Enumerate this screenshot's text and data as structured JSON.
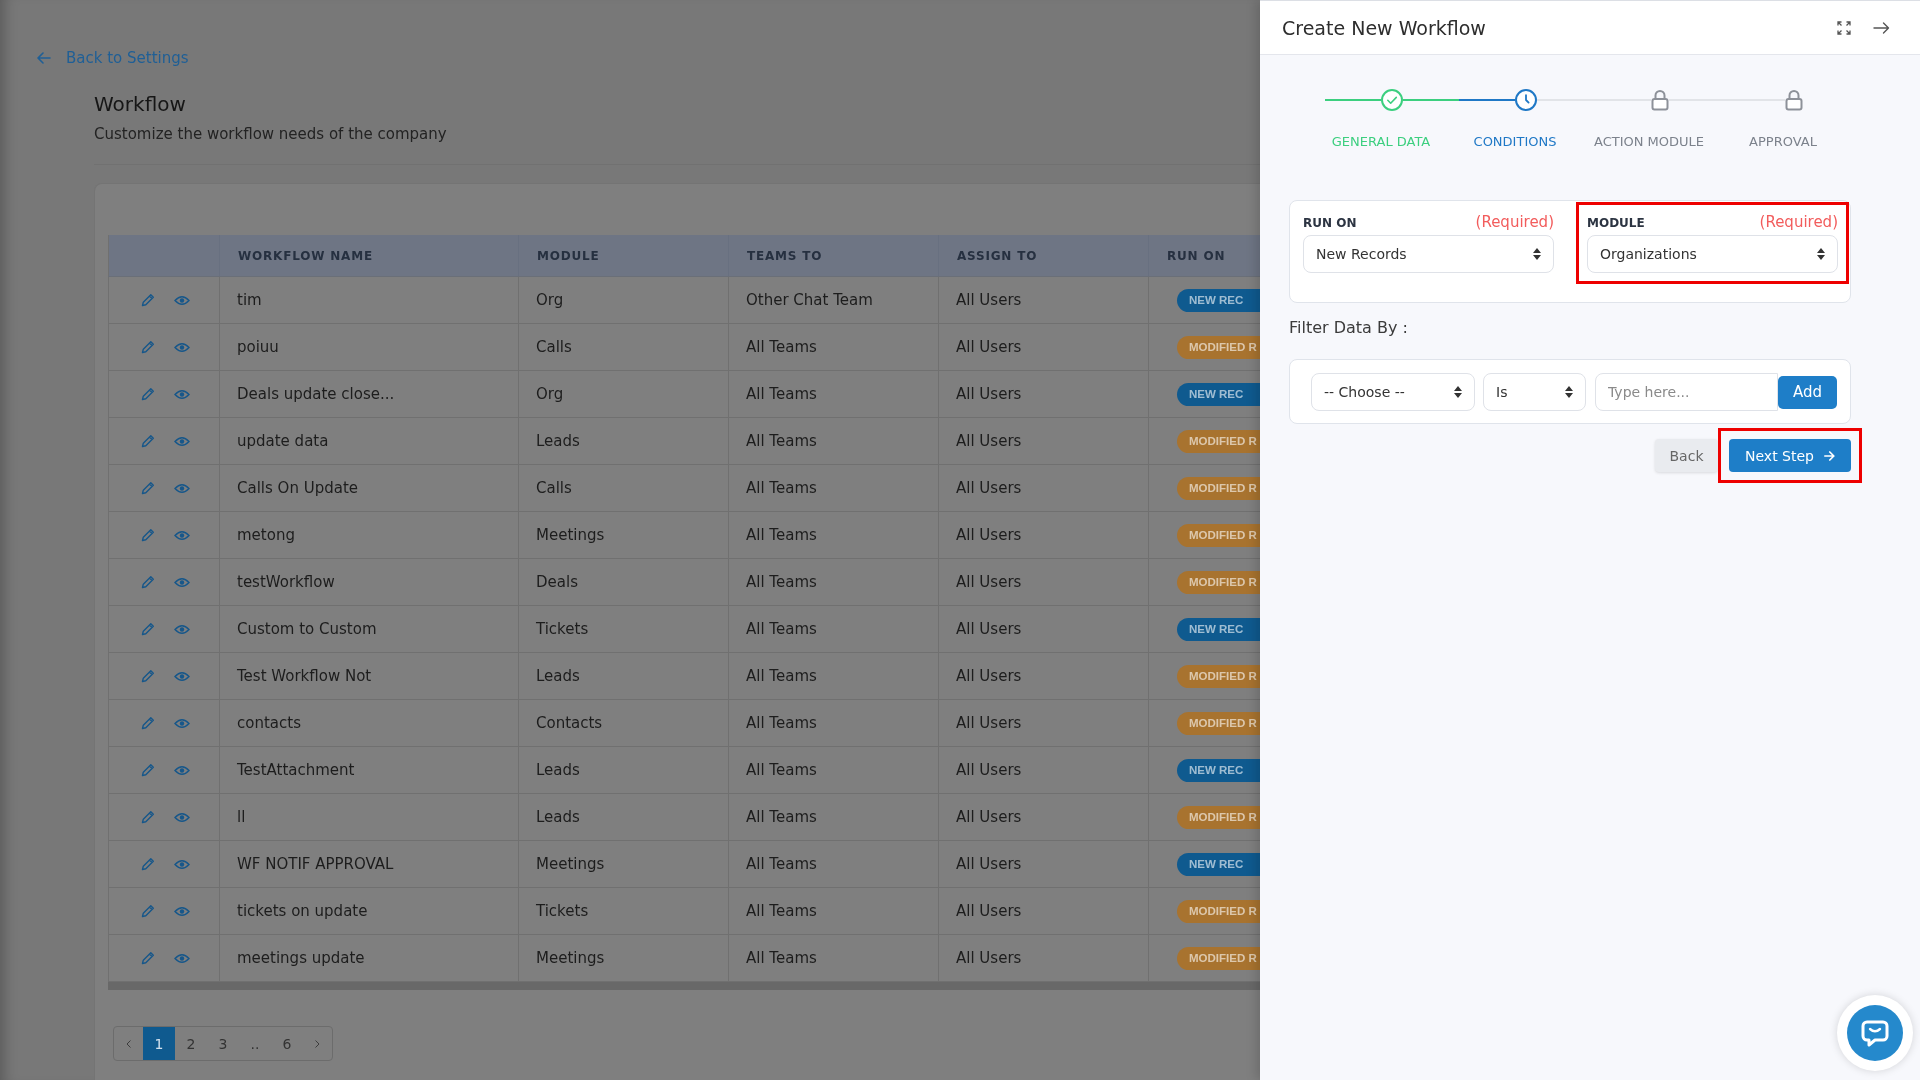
{
  "back_link": {
    "label": "Back to Settings"
  },
  "page": {
    "title": "Workflow",
    "subtitle": "Customize the workflow needs of the company"
  },
  "table": {
    "columns": [
      "WORKFLOW NAME",
      "MODULE",
      "TEAMS TO",
      "ASSIGN TO",
      "RUN ON"
    ],
    "rows": [
      {
        "name": "tim",
        "module": "Org",
        "teams_to": "Other Chat Team",
        "assign_to": "All Users",
        "run_on": {
          "label": "NEW REC",
          "color": "#0f5a8f"
        }
      },
      {
        "name": "poiuu",
        "module": "Calls",
        "teams_to": "All Teams",
        "assign_to": "All Users",
        "run_on": {
          "label": "MODIFIED R",
          "color": "#a8732f"
        }
      },
      {
        "name": "Deals update close...",
        "module": "Org",
        "teams_to": "All Teams",
        "assign_to": "All Users",
        "run_on": {
          "label": "NEW REC",
          "color": "#0f5a8f"
        }
      },
      {
        "name": "update data",
        "module": "Leads",
        "teams_to": "All Teams",
        "assign_to": "All Users",
        "run_on": {
          "label": "MODIFIED R",
          "color": "#a8732f"
        }
      },
      {
        "name": "Calls On Update",
        "module": "Calls",
        "teams_to": "All Teams",
        "assign_to": "All Users",
        "run_on": {
          "label": "MODIFIED R",
          "color": "#a8732f"
        }
      },
      {
        "name": "metong",
        "module": "Meetings",
        "teams_to": "All Teams",
        "assign_to": "All Users",
        "run_on": {
          "label": "MODIFIED R",
          "color": "#a8732f"
        }
      },
      {
        "name": "testWorkflow",
        "module": "Deals",
        "teams_to": "All Teams",
        "assign_to": "All Users",
        "run_on": {
          "label": "MODIFIED R",
          "color": "#a8732f"
        }
      },
      {
        "name": "Custom to Custom",
        "module": "Tickets",
        "teams_to": "All Teams",
        "assign_to": "All Users",
        "run_on": {
          "label": "NEW REC",
          "color": "#0f5a8f"
        }
      },
      {
        "name": "Test Workflow Not",
        "module": "Leads",
        "teams_to": "All Teams",
        "assign_to": "All Users",
        "run_on": {
          "label": "MODIFIED R",
          "color": "#a8732f"
        }
      },
      {
        "name": "contacts",
        "module": "Contacts",
        "teams_to": "All Teams",
        "assign_to": "All Users",
        "run_on": {
          "label": "MODIFIED R",
          "color": "#a8732f"
        }
      },
      {
        "name": "TestAttachment",
        "module": "Leads",
        "teams_to": "All Teams",
        "assign_to": "All Users",
        "run_on": {
          "label": "NEW REC",
          "color": "#0f5a8f"
        }
      },
      {
        "name": "ll",
        "module": "Leads",
        "teams_to": "All Teams",
        "assign_to": "All Users",
        "run_on": {
          "label": "MODIFIED R",
          "color": "#a8732f"
        }
      },
      {
        "name": "WF NOTIF APPROVAL",
        "module": "Meetings",
        "teams_to": "All Teams",
        "assign_to": "All Users",
        "run_on": {
          "label": "NEW REC",
          "color": "#0f5a8f"
        }
      },
      {
        "name": "tickets on update",
        "module": "Tickets",
        "teams_to": "All Teams",
        "assign_to": "All Users",
        "run_on": {
          "label": "MODIFIED R",
          "color": "#a8732f"
        }
      },
      {
        "name": "meetings update",
        "module": "Meetings",
        "teams_to": "All Teams",
        "assign_to": "All Users",
        "run_on": {
          "label": "MODIFIED R",
          "color": "#a8732f"
        }
      }
    ]
  },
  "pagination": {
    "pages": [
      {
        "label": "1",
        "selected": true
      },
      {
        "label": "2",
        "selected": false
      },
      {
        "label": "3",
        "selected": false
      },
      {
        "label": "..",
        "selected": false
      },
      {
        "label": "6",
        "selected": false
      }
    ]
  },
  "panel": {
    "title": "Create New Workflow",
    "steps": [
      {
        "label": "GENERAL DATA",
        "kind": "done"
      },
      {
        "label": "CONDITIONS",
        "kind": "current"
      },
      {
        "label": "ACTION MODULE",
        "kind": "locked"
      },
      {
        "label": "APPROVAL",
        "kind": "locked"
      }
    ],
    "fields": [
      {
        "label": "RUN ON",
        "note": "(Required)",
        "value": "New Records",
        "highlighted": false
      },
      {
        "label": "MODULE",
        "note": "(Required)",
        "value": "Organizations",
        "highlighted": true
      }
    ],
    "filter_label": "Filter Data By :",
    "filter": {
      "field": "-- Choose --",
      "operator": "Is",
      "placeholder": "Type here...",
      "add_button": "Add"
    },
    "buttons": [
      {
        "label": "Back",
        "kind": "secondary",
        "highlighted": false
      },
      {
        "label": "Next Step",
        "kind": "primary",
        "highlighted": true
      }
    ]
  }
}
